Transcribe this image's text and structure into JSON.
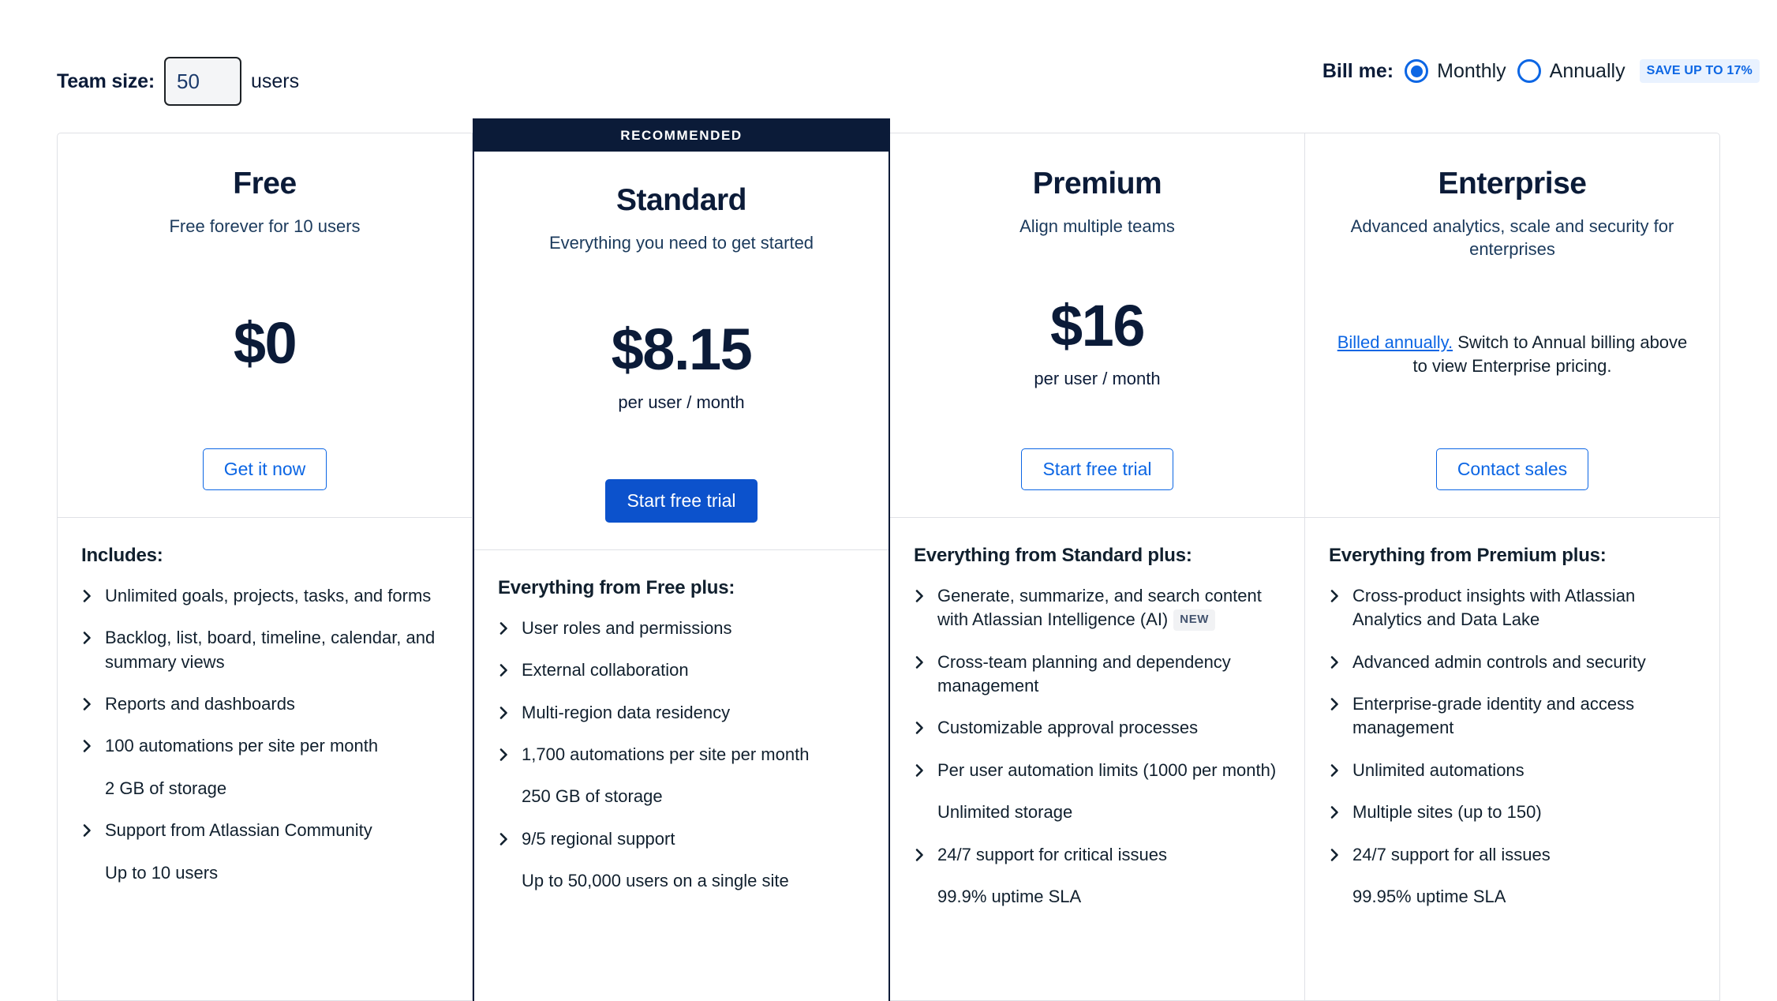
{
  "controls": {
    "team_size_label": "Team size:",
    "team_size_value": "50",
    "team_size_unit": "users",
    "bill_me_label": "Bill me:",
    "monthly_label": "Monthly",
    "annually_label": "Annually",
    "save_badge": "SAVE UP TO 17%",
    "selected_billing": "Monthly"
  },
  "colors": {
    "accent_blue": "#0c66e4",
    "primary_button": "#0c52cc",
    "dark_navy": "#0b1b38",
    "badge_bg": "#e9f2ff",
    "new_badge_bg": "#f1f2f4"
  },
  "plans": [
    {
      "name": "Free",
      "tagline": "Free forever for 10 users",
      "price": "$0",
      "price_unit": "",
      "cta": "Get it now",
      "cta_style": "outline",
      "recommended": false,
      "ribbon": "",
      "features_title": "Includes:",
      "features": [
        {
          "text": "Unlimited goals, projects, tasks, and forms",
          "chevron": true
        },
        {
          "text": "Backlog, list, board, timeline, calendar, and summary views",
          "chevron": true
        },
        {
          "text": "Reports and dashboards",
          "chevron": true
        },
        {
          "text": "100 automations per site per month",
          "chevron": true
        },
        {
          "text": "2 GB of storage",
          "chevron": false
        },
        {
          "text": "Support from Atlassian Community",
          "chevron": true
        },
        {
          "text": "Up to 10 users",
          "chevron": false
        }
      ]
    },
    {
      "name": "Standard",
      "tagline": "Everything you need to get started",
      "price": "$8.15",
      "price_unit": "per user / month",
      "cta": "Start free trial",
      "cta_style": "primary",
      "recommended": true,
      "ribbon": "RECOMMENDED",
      "features_title": "Everything from Free plus:",
      "features": [
        {
          "text": "User roles and permissions",
          "chevron": true
        },
        {
          "text": "External collaboration",
          "chevron": true
        },
        {
          "text": "Multi-region data residency",
          "chevron": true
        },
        {
          "text": "1,700 automations per site per month",
          "chevron": true
        },
        {
          "text": "250 GB of storage",
          "chevron": false
        },
        {
          "text": "9/5 regional support",
          "chevron": true
        },
        {
          "text": "Up to 50,000 users on a single site",
          "chevron": false
        }
      ]
    },
    {
      "name": "Premium",
      "tagline": "Align multiple teams",
      "price": "$16",
      "price_unit": "per user / month",
      "cta": "Start free trial",
      "cta_style": "outline",
      "recommended": false,
      "ribbon": "",
      "features_title": "Everything from Standard plus:",
      "features": [
        {
          "text": "Generate, summarize, and search content with Atlassian Intelligence (AI)",
          "chevron": true,
          "badge": "NEW"
        },
        {
          "text": "Cross-team planning and dependency management",
          "chevron": true
        },
        {
          "text": "Customizable approval processes",
          "chevron": true
        },
        {
          "text": "Per user automation limits (1000 per month)",
          "chevron": true
        },
        {
          "text": "Unlimited storage",
          "chevron": false
        },
        {
          "text": "24/7 support for critical issues",
          "chevron": true
        },
        {
          "text": "99.9% uptime SLA",
          "chevron": false
        }
      ]
    },
    {
      "name": "Enterprise",
      "tagline": "Advanced analytics, scale and security for enterprises",
      "price": "",
      "price_unit": "",
      "note_link": "Billed annually.",
      "note_text": " Switch to Annual billing above to view Enterprise pricing.",
      "cta": "Contact sales",
      "cta_style": "outline",
      "recommended": false,
      "ribbon": "",
      "features_title": "Everything from Premium plus:",
      "features": [
        {
          "text": "Cross-product insights with Atlassian Analytics and Data Lake",
          "chevron": true
        },
        {
          "text": "Advanced admin controls and security",
          "chevron": true
        },
        {
          "text": "Enterprise-grade identity and access management",
          "chevron": true
        },
        {
          "text": "Unlimited automations",
          "chevron": true
        },
        {
          "text": "Multiple sites (up to 150)",
          "chevron": true
        },
        {
          "text": "24/7 support for all issues",
          "chevron": true
        },
        {
          "text": "99.95% uptime SLA",
          "chevron": false
        }
      ]
    }
  ]
}
